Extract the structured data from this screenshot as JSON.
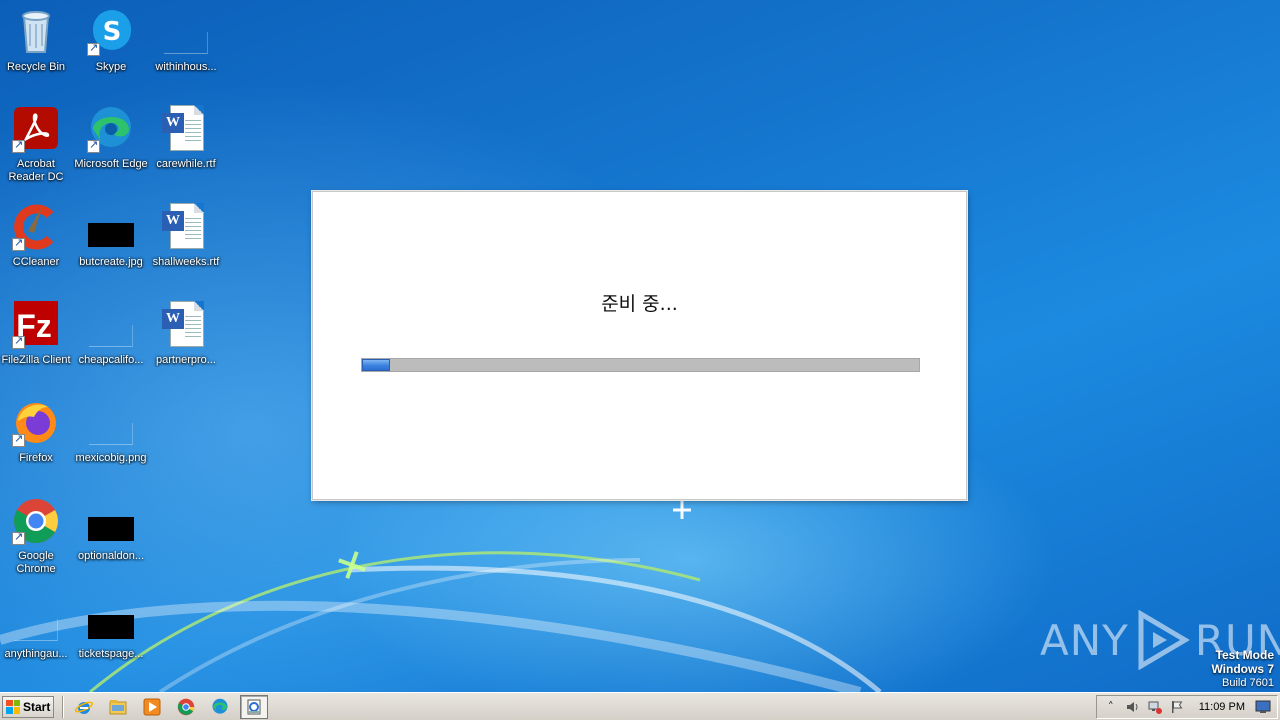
{
  "desktop": {
    "icons": [
      {
        "label": "Recycle Bin",
        "icon": "recycle-bin-icon"
      },
      {
        "label": "Skype",
        "icon": "skype-icon"
      },
      {
        "label": "withinhous...",
        "icon": "blank-file-icon"
      },
      {
        "label": "Acrobat Reader DC",
        "icon": "acrobat-icon"
      },
      {
        "label": "Microsoft Edge",
        "icon": "edge-icon"
      },
      {
        "label": "carewhile.rtf",
        "icon": "word-doc-icon"
      },
      {
        "label": "CCleaner",
        "icon": "ccleaner-icon"
      },
      {
        "label": "butcreate.jpg",
        "icon": "image-thumbnail-icon"
      },
      {
        "label": "shallweeks.rtf",
        "icon": "word-doc-icon"
      },
      {
        "label": "FileZilla Client",
        "icon": "filezilla-icon"
      },
      {
        "label": "cheapcalifo...",
        "icon": "blank-file-icon"
      },
      {
        "label": "partnerpro...",
        "icon": "word-doc-icon"
      },
      {
        "label": "Firefox",
        "icon": "firefox-icon"
      },
      {
        "label": "mexicobig.png",
        "icon": "blank-file-icon"
      },
      {
        "label": "Google Chrome",
        "icon": "chrome-icon"
      },
      {
        "label": "optionaldon...",
        "icon": "image-thumbnail-icon"
      },
      {
        "label": "anythingau...",
        "icon": "blank-file-icon"
      },
      {
        "label": "ticketspage...",
        "icon": "image-thumbnail-icon"
      }
    ]
  },
  "dialog": {
    "status_text": "준비 중...",
    "progress_fraction": 0.05
  },
  "watermark": {
    "brand_left": "ANY",
    "brand_right": "RUN"
  },
  "system_info": {
    "line1": "Test Mode",
    "line2": "Windows 7",
    "line3": "Build 7601"
  },
  "taskbar": {
    "start_label": "Start",
    "pinned": [
      {
        "icon": "internet-explorer-icon"
      },
      {
        "icon": "file-explorer-icon"
      },
      {
        "icon": "media-player-icon"
      },
      {
        "icon": "chrome-icon"
      },
      {
        "icon": "edge-icon"
      },
      {
        "icon": "installer-icon",
        "active": true
      }
    ],
    "tray_icons": [
      "show-hidden-icons-icon",
      "volume-icon",
      "network-icon",
      "action-center-flag-icon"
    ],
    "clock": "11:09 PM"
  },
  "colors": {
    "desktop_blue": "#1576cf",
    "progress_blue": "#3b82e0",
    "progress_track": "#bcbcbc"
  }
}
